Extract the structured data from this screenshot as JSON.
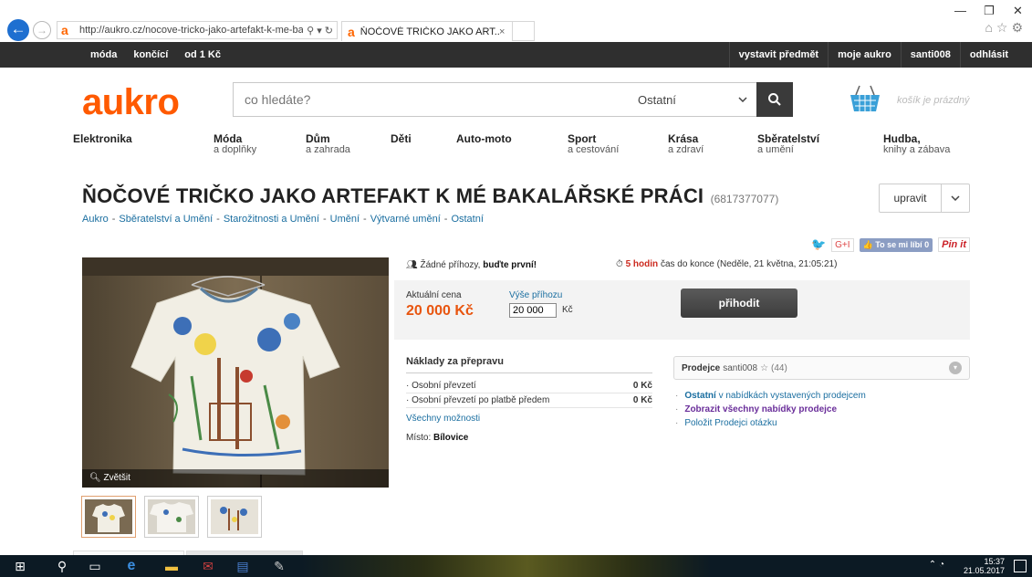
{
  "browser": {
    "url": "http://aukro.cz/nocove-tricko-jako-artefakt-k-me-bak",
    "url_tools": "⚲ ▾ ↻",
    "tab_title": "ŇOČOVÉ TRIČKO JAKO ART...",
    "tab_close": "×"
  },
  "topnav": {
    "left": [
      "móda",
      "končící",
      "od 1 Kč"
    ],
    "right": [
      "vystavit předmět",
      "moje aukro",
      "santi008",
      "odhlásit"
    ]
  },
  "header": {
    "logo": "aukro",
    "search_placeholder": "co hledáte?",
    "search_category": "Ostatní",
    "cart_text": "košík je prázdný"
  },
  "categories": [
    {
      "main": "Elektronika",
      "sub": ""
    },
    {
      "main": "Móda",
      "sub": "a doplňky"
    },
    {
      "main": "Dům",
      "sub": "a zahrada"
    },
    {
      "main": "Děti",
      "sub": ""
    },
    {
      "main": "Auto-moto",
      "sub": ""
    },
    {
      "main": "Sport",
      "sub": "a cestování"
    },
    {
      "main": "Krása",
      "sub": "a zdraví"
    },
    {
      "main": "Sběratelství",
      "sub": "a umění"
    },
    {
      "main": "Hudba,",
      "sub": "knihy a zábava"
    }
  ],
  "item": {
    "title": "ŇOČOVÉ TRIČKO JAKO ARTEFAKT K MÉ BAKALÁŘSKÉ PRÁCI",
    "id": "(6817377077)",
    "edit_label": "upravit"
  },
  "breadcrumb": [
    "Aukro",
    "Sběratelství a Umění",
    "Starožitnosti a Umění",
    "Umění",
    "Výtvarné umění",
    "Ostatní"
  ],
  "breadcrumb_sep": "-",
  "social": {
    "gplus": "G+I",
    "fb_like": "To se mi líbí 0",
    "pinterest": "Pin it"
  },
  "photo": {
    "zoom_label": "Zvětšit"
  },
  "bid": {
    "no_bids": "Žádné příhozy,",
    "be_first": "buďte první!",
    "time_left": "5 hodin",
    "time_until": "čas do konce (Neděle, 21 května, 21:05:21)",
    "current_price_label": "Aktuální cena",
    "current_price": "20 000 Kč",
    "bid_amount_label": "Výše příhozu",
    "bid_amount_value": "20 000",
    "bid_currency": "Kč",
    "bid_button": "přihodit"
  },
  "shipping": {
    "title": "Náklady za přepravu",
    "rows": [
      {
        "label": "· Osobní převzetí",
        "price": "0 Kč"
      },
      {
        "label": "· Osobní převzetí po platbě předem",
        "price": "0 Kč"
      }
    ],
    "all_options": "Všechny možnosti",
    "place_label": "Místo:",
    "place_value": "Bílovice"
  },
  "seller": {
    "label": "Prodejce",
    "name": "santi008",
    "rating": "(44)",
    "links": {
      "other_bold": "Ostatní",
      "other_rest": "v nabídkách vystavených prodejcem",
      "show_all": "Zobrazit všechny nabídky prodejce",
      "ask": "Položit Prodejci otázku"
    }
  },
  "taskbar": {
    "time": "15:37",
    "date": "21.05.2017"
  },
  "colors": {
    "brand": "#ff5a00",
    "link": "#1a6ea0",
    "price": "#e8550f",
    "topnav": "#2f2f2f"
  }
}
